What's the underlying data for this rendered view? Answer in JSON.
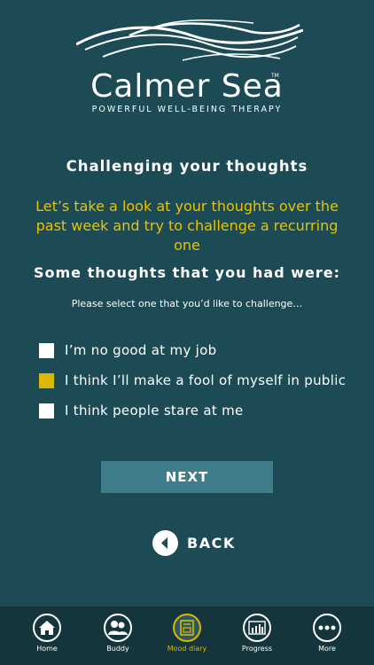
{
  "brand": {
    "name": "Calmer Sea",
    "tm": "TM",
    "tagline": "POWERFUL WELL-BEING THERAPY"
  },
  "title": "Challenging your thoughts",
  "intro": "Let’s take a look at your thoughts over the past week and try to challenge a recurring one",
  "section_heading": "Some thoughts that you had were:",
  "instruction": "Please select one that you’d like to challenge…",
  "options": [
    {
      "label": "I’m no good at my job",
      "checked": false
    },
    {
      "label": "I think I’ll make a fool of myself in public",
      "checked": true
    },
    {
      "label": "I think people stare at me",
      "checked": false
    }
  ],
  "next_label": "NEXT",
  "back_label": "BACK",
  "tabs": [
    {
      "label": "Home",
      "icon": "home-icon",
      "active": false
    },
    {
      "label": "Buddy",
      "icon": "buddy-icon",
      "active": false
    },
    {
      "label": "Mood diary",
      "icon": "mood-diary-icon",
      "active": true
    },
    {
      "label": "Progress",
      "icon": "progress-icon",
      "active": false
    },
    {
      "label": "More",
      "icon": "more-icon",
      "active": false
    }
  ],
  "colors": {
    "background": "#1c4a55",
    "accent_yellow": "#e9c300",
    "button": "#3f7d8b",
    "tabbar": "#15353d"
  }
}
